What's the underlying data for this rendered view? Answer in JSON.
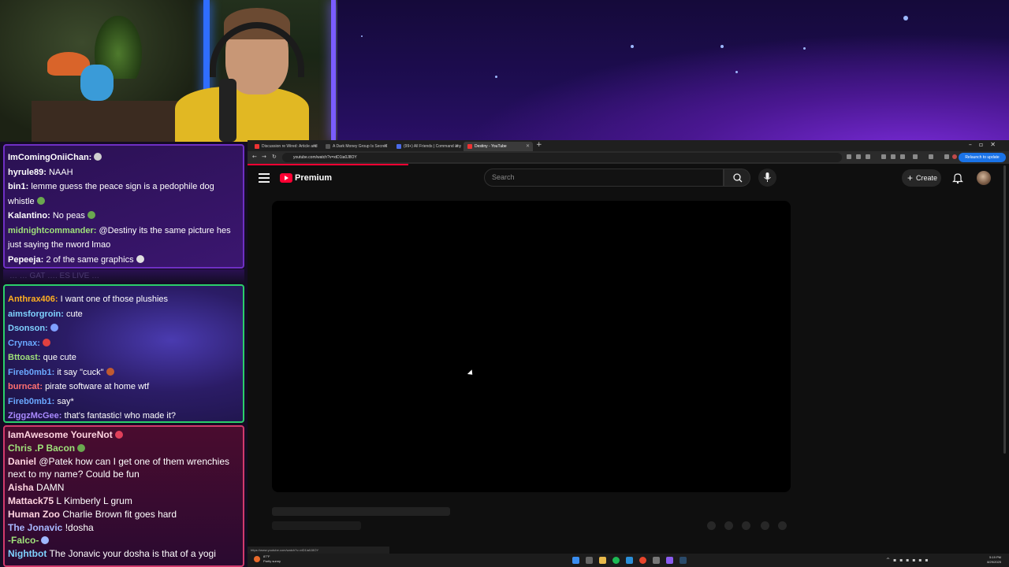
{
  "chat_top": {
    "lines": [
      {
        "user": "ImComingOniiChan:",
        "text": "",
        "color": "#ffffff",
        "emote": "#cfcfcf"
      },
      {
        "user": "hyrule89:",
        "text": "NAAH",
        "color": "#ffffff"
      },
      {
        "user": "bin1:",
        "text": "lemme guess the peace sign is a pedophile dog whistle",
        "color": "#ffffff",
        "emote": "#6aa84f"
      },
      {
        "user": "Kalantino:",
        "text": "No peas",
        "color": "#ffffff",
        "emote": "#6aa84f"
      },
      {
        "user": "midnightcommander:",
        "text": "@Destiny its the same picture hes just saying the nword lmao",
        "color": "#9fe07a"
      },
      {
        "user": "Pepeeja:",
        "text": "2 of the same graphics",
        "color": "#ffffff",
        "emote": "#e0e0e0"
      }
    ],
    "faded": "… … GAT …. ES LIVE …"
  },
  "chat_mid": {
    "lines": [
      {
        "user": "Anthrax406:",
        "text": "I want one of those plushies",
        "color": "#ffb020"
      },
      {
        "user": "aimsforgroin:",
        "text": "cute",
        "color": "#7fd2ff"
      },
      {
        "user": "Dsonson:",
        "text": "",
        "color": "#7fd2ff",
        "emote": "#7fa0ff"
      },
      {
        "user": "Crynax:",
        "text": "",
        "color": "#6aa8ff",
        "emote": "#e04040"
      },
      {
        "user": "Bttoast:",
        "text": "que cute",
        "color": "#9fe07a"
      },
      {
        "user": "Fireb0mb1:",
        "text": "it say \"cuck\"",
        "color": "#6aa8ff",
        "emote": "#c05a30"
      },
      {
        "user": "burncat:",
        "text": "pirate software at home wtf",
        "color": "#ff7070"
      },
      {
        "user": "Fireb0mb1:",
        "text": "say*",
        "color": "#6aa8ff"
      },
      {
        "user": "ZiggzMcGee:",
        "text": "that's fantastic! who made it?",
        "color": "#a98aff"
      }
    ]
  },
  "chat_bottom": {
    "lines": [
      {
        "user": "IamAwesome YoureNot",
        "text": "",
        "color": "#ffd4e0",
        "emote": "#e0405a"
      },
      {
        "user": "Chris .P Bacon",
        "text": "",
        "color": "#9fe07a",
        "emote": "#6aa84f"
      },
      {
        "user": "Daniel",
        "text": "@Patek how can I get one of them wrenchies next to my name? Could be fun",
        "color": "#ffd4e0"
      },
      {
        "user": "Aisha",
        "text": "DAMN",
        "color": "#ffd4e0"
      },
      {
        "user": "Mattack75",
        "text": "L Kimberly L grum",
        "color": "#ffd4e0"
      },
      {
        "user": "Human Zoo",
        "text": "Charlie Brown fit goes hard",
        "color": "#ffd4e0"
      },
      {
        "user": "The Jonavic",
        "text": "!dosha",
        "color": "#a8b8ff"
      },
      {
        "user": "-Falco-",
        "text": "",
        "color": "#9fe07a",
        "emote": "#9fb8ff"
      },
      {
        "user": "Nightbot",
        "text": "The Jonavic your dosha is that of a yogi",
        "color": "#7fd2ff"
      }
    ]
  },
  "browser": {
    "tabs": [
      {
        "title": "Discussion re Wired: Article and",
        "active": false
      },
      {
        "title": "A Dark Money Group Is Secretl",
        "active": false
      },
      {
        "title": "(99+) All Friends | Command any",
        "active": false
      },
      {
        "title": "Destiny - YouTube",
        "active": true
      }
    ],
    "url": "youtube.com/watch?v=xtD1ia0J8OY",
    "relaunch_label": "Relaunch to update",
    "status_url": "https://www.youtube.com/watch?v=xtD1ia0J8OY"
  },
  "youtube": {
    "logo": "Premium",
    "search_placeholder": "Search",
    "create_label": "Create"
  },
  "taskbar": {
    "temperature": "87°F",
    "weather": "Partly sunny",
    "time": "5:19 PM",
    "date": "8/29/2025"
  },
  "colors": {
    "youtube_red": "#ff0033",
    "chat_panel_top_border": "#6f2fc4",
    "chat_panel_mid_border": "#2bcf6a",
    "chat_panel_bottom_border": "#d23a6c"
  },
  "icons": [
    "hamburger-menu-icon",
    "search-icon",
    "microphone-icon",
    "bell-icon",
    "plus-icon",
    "windows-start-icon"
  ]
}
